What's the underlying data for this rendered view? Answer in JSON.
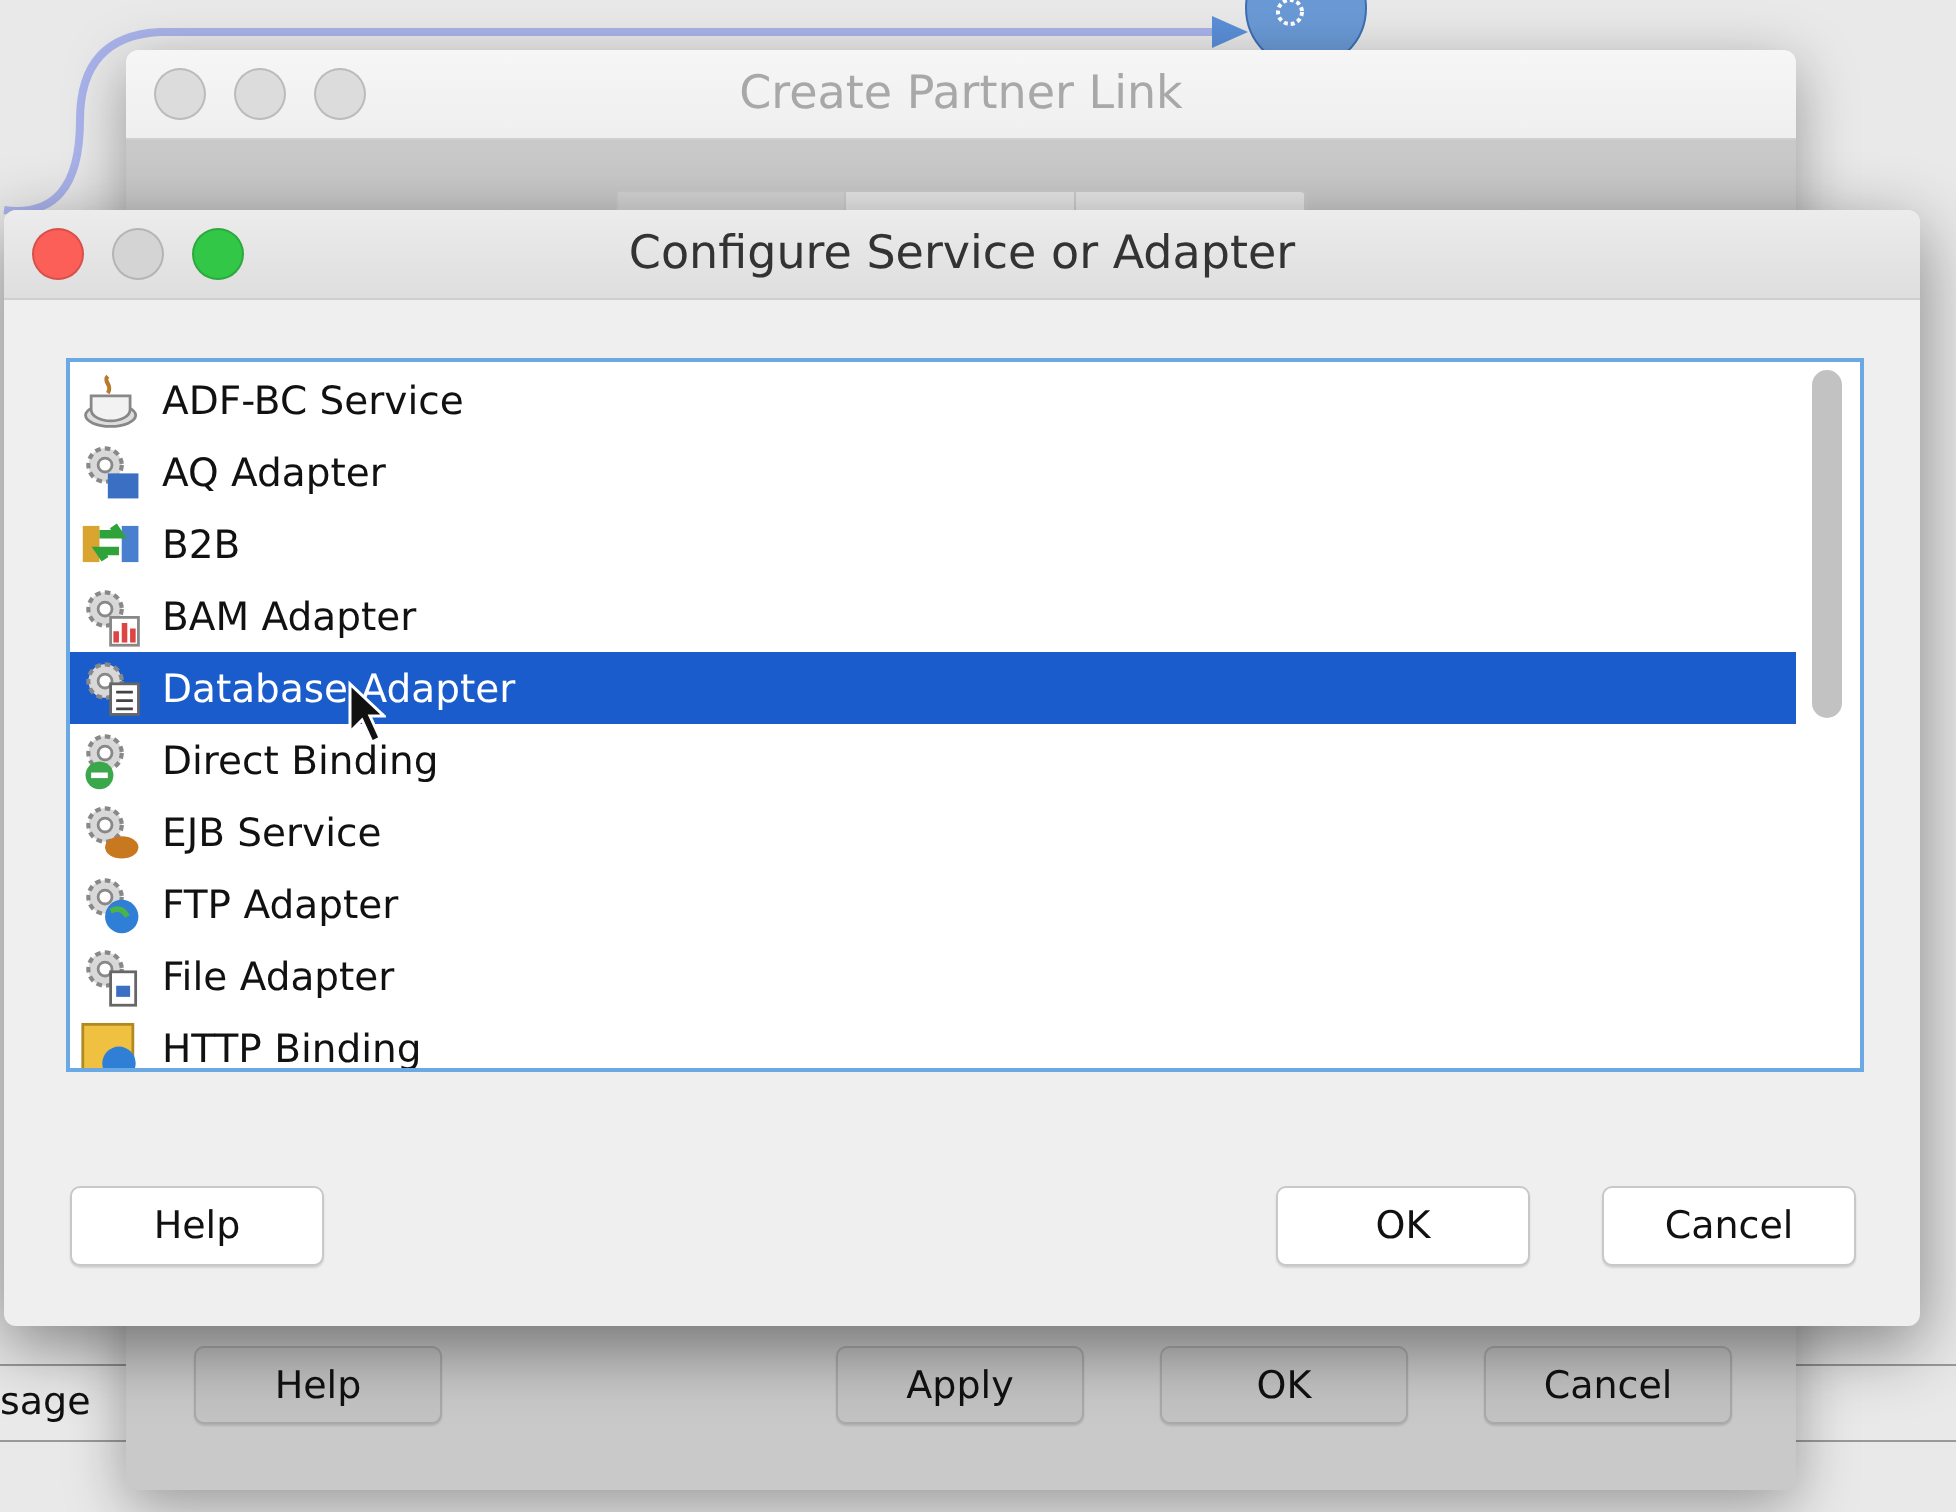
{
  "background": {
    "texts": [
      "sage"
    ]
  },
  "back_dialog": {
    "title": "Create Partner Link",
    "buttons": [
      "Help",
      "Apply",
      "OK",
      "Cancel"
    ]
  },
  "dialog": {
    "title": "Configure Service or Adapter",
    "items": [
      {
        "label": "ADF-BC Service",
        "selected": false
      },
      {
        "label": "AQ Adapter",
        "selected": false
      },
      {
        "label": "B2B",
        "selected": false
      },
      {
        "label": "BAM Adapter",
        "selected": false
      },
      {
        "label": "Database Adapter",
        "selected": true
      },
      {
        "label": "Direct Binding",
        "selected": false
      },
      {
        "label": "EJB Service",
        "selected": false
      },
      {
        "label": "FTP Adapter",
        "selected": false
      },
      {
        "label": "File Adapter",
        "selected": false
      },
      {
        "label": "HTTP Binding",
        "selected": false
      }
    ],
    "buttons": {
      "left": [
        "Help"
      ],
      "right": [
        "OK",
        "Cancel"
      ]
    }
  }
}
